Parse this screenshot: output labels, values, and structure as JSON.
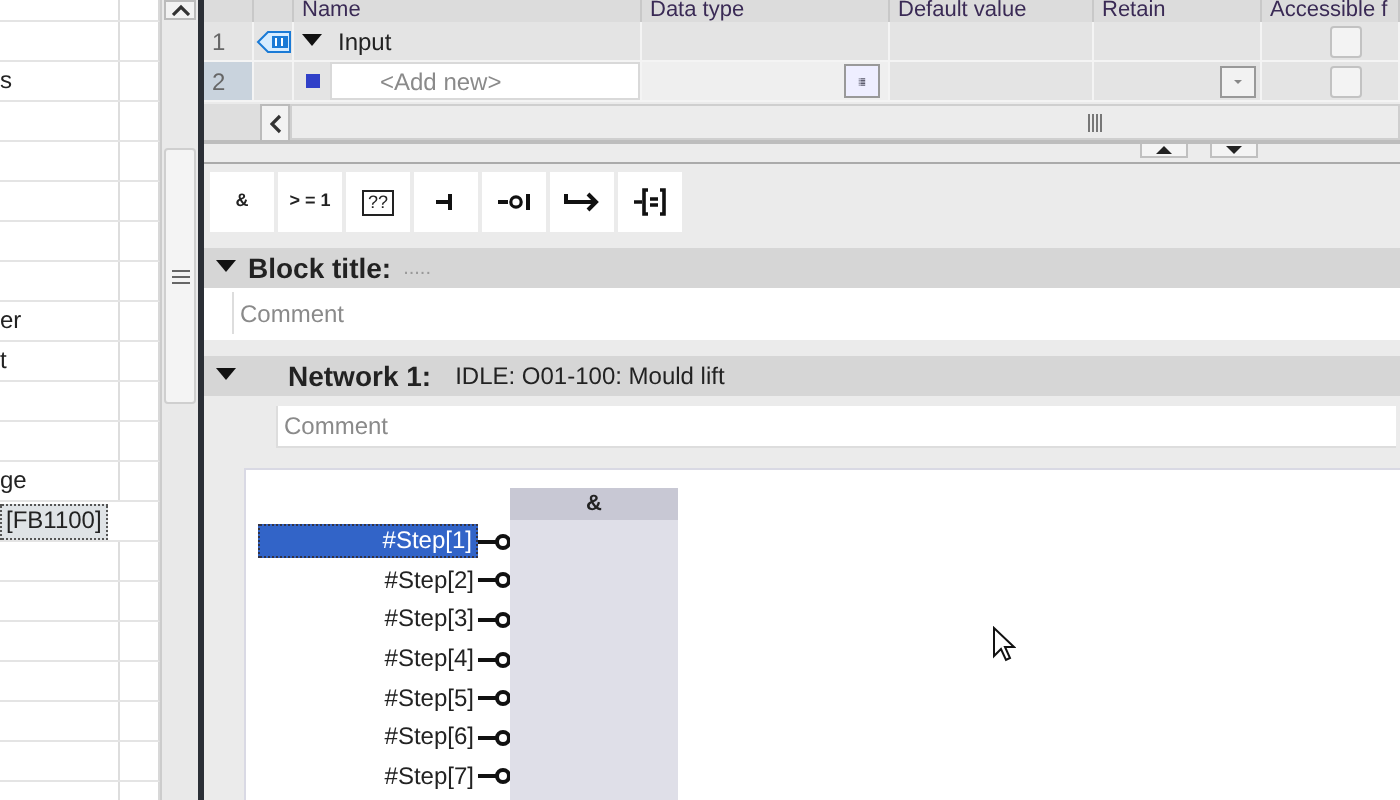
{
  "sidebar": {
    "rows": [
      {
        "selected": false
      },
      {
        "selected": false
      },
      {
        "text": "s",
        "selected": false
      },
      {
        "selected": false
      },
      {
        "selected": false
      },
      {
        "selected": false
      },
      {
        "selected": false
      },
      {
        "selected": false
      },
      {
        "text": "er",
        "selected": false
      },
      {
        "text": "t",
        "selected": false
      },
      {
        "selected": false
      },
      {
        "selected": false
      },
      {
        "text": "ge",
        "selected": false
      },
      {
        "text": "[FB1100]",
        "selected": true
      },
      {
        "selected": false
      },
      {
        "selected": false
      },
      {
        "selected": false
      },
      {
        "selected": false
      },
      {
        "selected": false
      },
      {
        "selected": false
      },
      {
        "selected": false
      }
    ]
  },
  "interface_table": {
    "columns": [
      "Name",
      "Data type",
      "Default value",
      "Retain",
      "Accessible f"
    ],
    "rows": [
      {
        "number": "1",
        "kind": "section",
        "name": "Input",
        "expanded": true,
        "selected": false,
        "accessible_checked": false
      },
      {
        "number": "2",
        "kind": "new",
        "placeholder": "<Add new>",
        "selected": true,
        "accessible_checked": false
      }
    ]
  },
  "toolbar": [
    {
      "kind": "text",
      "label": "&"
    },
    {
      "kind": "text",
      "label": "> = 1"
    },
    {
      "kind": "box",
      "label": "??"
    },
    {
      "kind": "contact"
    },
    {
      "kind": "negated-contact"
    },
    {
      "kind": "arrow"
    },
    {
      "kind": "assign"
    }
  ],
  "block": {
    "title": "Block title:",
    "title_value": ".....",
    "expanded": true,
    "comment_placeholder": "Comment"
  },
  "networks": [
    {
      "title": "Network 1:",
      "description": "IDLE: O01-100: Mould lift",
      "expanded": true,
      "comment_placeholder": "Comment",
      "box": {
        "operator": "&",
        "inputs": [
          {
            "label": "#Step[1]",
            "selected": true,
            "negated": true
          },
          {
            "label": "#Step[2]",
            "selected": false,
            "negated": true
          },
          {
            "label": "#Step[3]",
            "selected": false,
            "negated": true
          },
          {
            "label": "#Step[4]",
            "selected": false,
            "negated": true
          },
          {
            "label": "#Step[5]",
            "selected": false,
            "negated": true
          },
          {
            "label": "#Step[6]",
            "selected": false,
            "negated": true
          },
          {
            "label": "#Step[7]",
            "selected": false,
            "negated": true
          }
        ]
      }
    }
  ]
}
